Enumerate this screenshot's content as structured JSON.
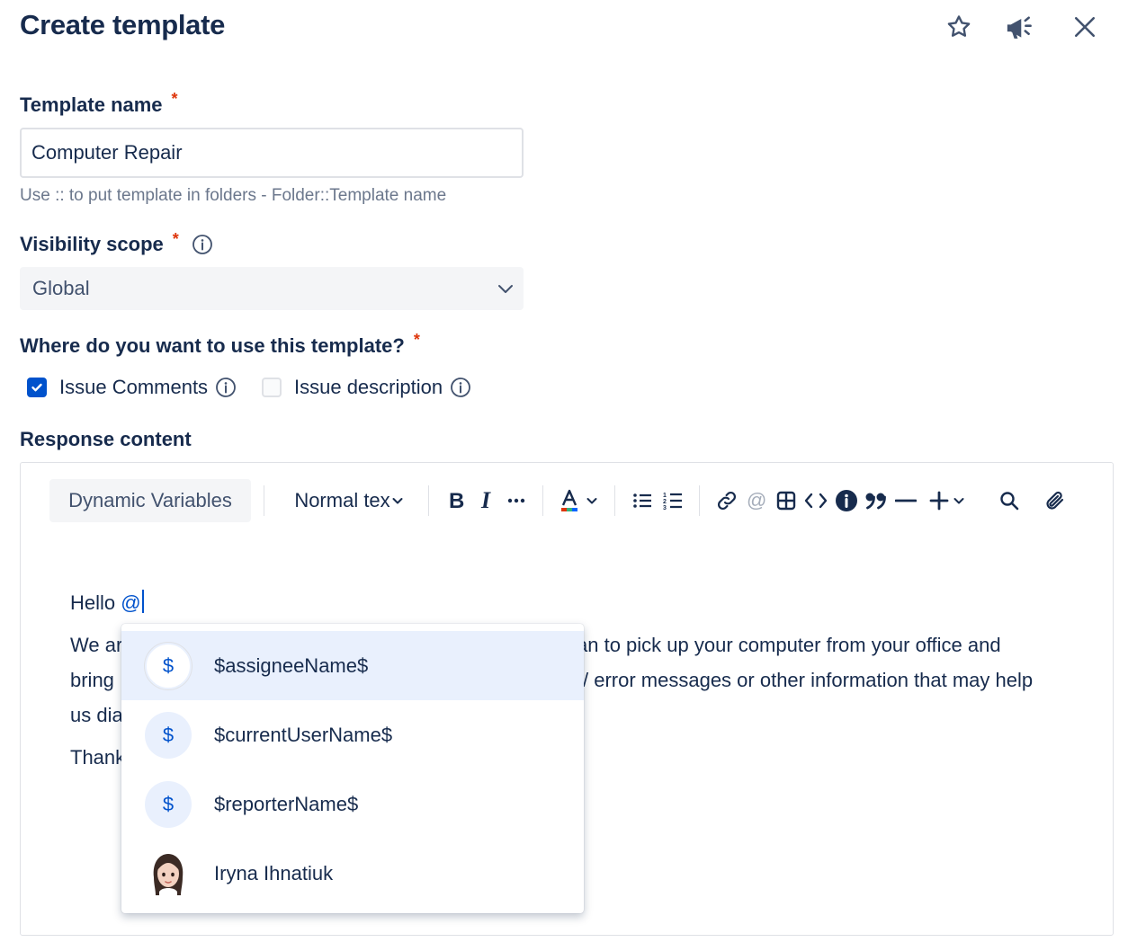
{
  "header": {
    "title": "Create template",
    "star_icon": "star-icon",
    "feedback_icon": "megaphone-icon",
    "close_icon": "close-icon"
  },
  "form": {
    "template_name": {
      "label": "Template name",
      "required": "*",
      "value": "Computer Repair",
      "helper": "Use :: to put template in folders - Folder::Template name"
    },
    "visibility": {
      "label": "Visibility scope",
      "required": "*",
      "selected": "Global"
    },
    "usage": {
      "label": "Where do you want to use this template?",
      "required": "*",
      "options": [
        {
          "label": "Issue Comments",
          "checked": true
        },
        {
          "label": "Issue description",
          "checked": false
        }
      ]
    },
    "response": {
      "label": "Response content"
    }
  },
  "toolbar": {
    "dynamic_variables": "Dynamic Variables",
    "text_style": "Normal tex"
  },
  "content": {
    "line1_prefix": "Hello ",
    "line1_mention": "@",
    "para2_a": "We ar",
    "para2_b": "an to pick up your computer from your office and",
    "para2_c": "bring",
    "para2_d": "/ error messages or other information that may help",
    "para2_e": "us dia",
    "para3": "Thank"
  },
  "mention_popup": {
    "items": [
      {
        "label": "$assigneeName$",
        "icon": "$"
      },
      {
        "label": "$currentUserName$",
        "icon": "$"
      },
      {
        "label": "$reporterName$",
        "icon": "$"
      },
      {
        "label": "Iryna Ihnatiuk",
        "icon": "user-avatar"
      }
    ]
  },
  "colors": {
    "text": "#172b4d",
    "required": "#de350b",
    "accent": "#0052cc",
    "active_item": "#e9f0fd",
    "field_bg": "#f4f5f7"
  }
}
